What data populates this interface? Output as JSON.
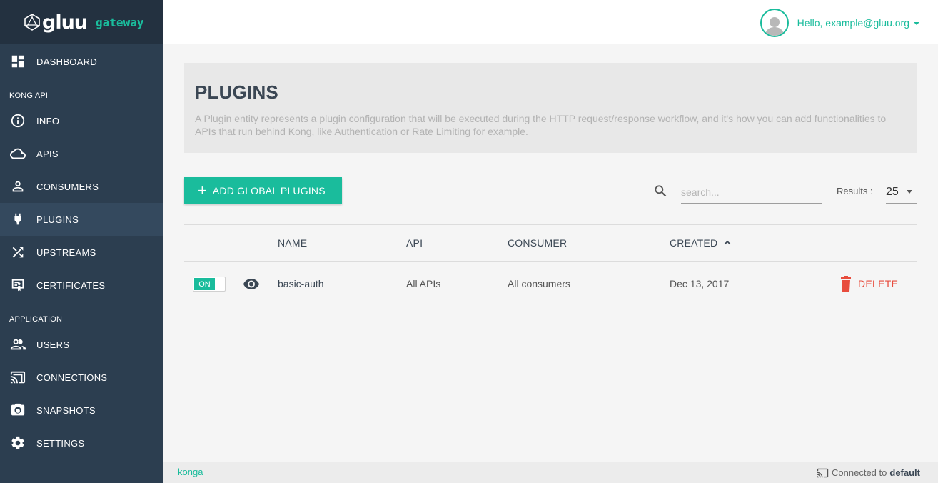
{
  "brand": {
    "logo": "gluu",
    "sub": "gateway"
  },
  "sidebar": {
    "dashboard": "DASHBOARD",
    "section_kong": "KONG API",
    "kong_items": [
      {
        "label": "INFO",
        "icon": "info-icon"
      },
      {
        "label": "APIS",
        "icon": "cloud-icon"
      },
      {
        "label": "CONSUMERS",
        "icon": "person-icon"
      },
      {
        "label": "PLUGINS",
        "icon": "plug-icon",
        "active": true
      },
      {
        "label": "UPSTREAMS",
        "icon": "shuffle-icon"
      },
      {
        "label": "CERTIFICATES",
        "icon": "certificate-icon"
      }
    ],
    "section_app": "APPLICATION",
    "app_items": [
      {
        "label": "USERS",
        "icon": "users-icon"
      },
      {
        "label": "CONNECTIONS",
        "icon": "cast-icon"
      },
      {
        "label": "SNAPSHOTS",
        "icon": "camera-icon"
      },
      {
        "label": "SETTINGS",
        "icon": "gear-icon"
      }
    ]
  },
  "header": {
    "greeting": "Hello, example@gluu.org"
  },
  "page": {
    "title": "PLUGINS",
    "description": "A Plugin entity represents a plugin configuration that will be executed during the HTTP request/response workflow, and it's how you can add functionalities to APIs that run behind Kong, like Authentication or Rate Limiting for example."
  },
  "toolbar": {
    "add_label": "ADD GLOBAL PLUGINS",
    "search_placeholder": "search...",
    "results_label": "Results :",
    "results_value": "25"
  },
  "table": {
    "columns": {
      "name": "NAME",
      "api": "API",
      "consumer": "CONSUMER",
      "created": "CREATED"
    },
    "rows": [
      {
        "toggle": "ON",
        "name": "basic-auth",
        "api": "All APIs",
        "consumer": "All consumers",
        "created": "Dec 13, 2017",
        "delete": "DELETE"
      }
    ]
  },
  "footer": {
    "app": "konga",
    "connected_prefix": "Connected to",
    "connection": "default"
  },
  "colors": {
    "sidebar": "#2c3e50",
    "accent": "#1abc9c",
    "danger": "#e84c3d"
  }
}
